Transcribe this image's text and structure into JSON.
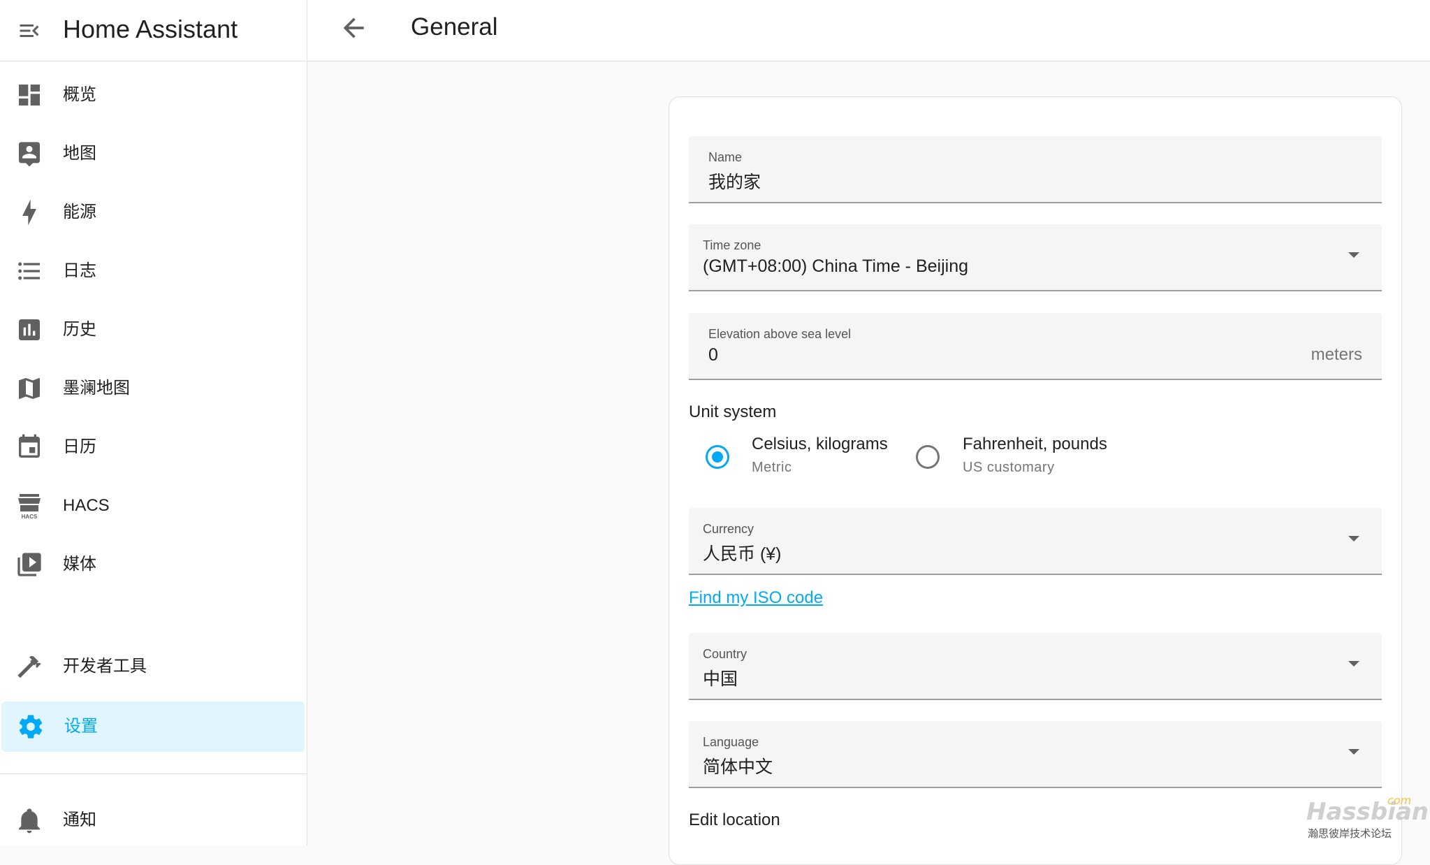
{
  "app": {
    "title": "Home Assistant"
  },
  "sidebar": {
    "items": [
      {
        "label": "概览",
        "icon": "dashboard-icon"
      },
      {
        "label": "地图",
        "icon": "map-account-icon"
      },
      {
        "label": "能源",
        "icon": "lightning-icon"
      },
      {
        "label": "日志",
        "icon": "list-icon"
      },
      {
        "label": "历史",
        "icon": "chart-box-icon"
      },
      {
        "label": "墨澜地图",
        "icon": "folded-map-icon"
      },
      {
        "label": "日历",
        "icon": "calendar-icon"
      },
      {
        "label": "HACS",
        "icon": "hacs-icon"
      },
      {
        "label": "媒体",
        "icon": "play-box-icon"
      },
      {
        "label": "开发者工具",
        "icon": "hammer-icon"
      },
      {
        "label": "设置",
        "icon": "gear-icon",
        "active": true
      },
      {
        "label": "通知",
        "icon": "bell-icon"
      }
    ],
    "hacs_icon_text": "HACS"
  },
  "header": {
    "title": "General"
  },
  "form": {
    "name": {
      "label": "Name",
      "value": "我的家"
    },
    "timezone": {
      "label": "Time zone",
      "value": "(GMT+08:00) China Time - Beijing"
    },
    "elevation": {
      "label": "Elevation above sea level",
      "value": "0",
      "suffix": "meters"
    },
    "unit_system": {
      "title": "Unit system",
      "options": [
        {
          "main": "Celsius, kilograms",
          "sub": "Metric",
          "checked": true
        },
        {
          "main": "Fahrenheit, pounds",
          "sub": "US customary",
          "checked": false
        }
      ]
    },
    "currency": {
      "label": "Currency",
      "value": "人民币 (¥)"
    },
    "iso_link": "Find my ISO code",
    "country": {
      "label": "Country",
      "value": "中国"
    },
    "language": {
      "label": "Language",
      "value": "简体中文"
    },
    "edit_location": "Edit location"
  },
  "watermark": {
    "brand": "Hassbian",
    "tld": "com",
    "tagline": "瀚思彼岸技术论坛"
  },
  "colors": {
    "accent": "#03a9f4",
    "active_bg": "#e1f5fe",
    "icon": "#616161"
  }
}
